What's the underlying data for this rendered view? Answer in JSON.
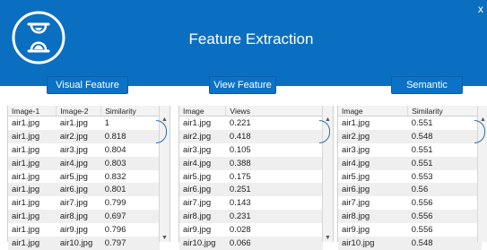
{
  "app": {
    "title": "Feature Extraction",
    "close_label": "x"
  },
  "buttons": {
    "visual": "Visual Feature",
    "view": "View Feature",
    "semantic": "Semantic Feature"
  },
  "visual_table": {
    "headers": [
      "Image-1",
      "Image-2",
      "Similarity"
    ],
    "rows": [
      [
        "air1.jpg",
        "air1.jpg",
        "1"
      ],
      [
        "air1.jpg",
        "air2.jpg",
        "0.818"
      ],
      [
        "air1.jpg",
        "air3.jpg",
        "0.804"
      ],
      [
        "air1.jpg",
        "air4.jpg",
        "0.803"
      ],
      [
        "air1.jpg",
        "air5.jpg",
        "0.832"
      ],
      [
        "air1.jpg",
        "air6.jpg",
        "0.801"
      ],
      [
        "air1.jpg",
        "air7.jpg",
        "0.799"
      ],
      [
        "air1.jpg",
        "air8.jpg",
        "0.697"
      ],
      [
        "air1.jpg",
        "air9.jpg",
        "0.796"
      ],
      [
        "air1.jpg",
        "air10.jpg",
        "0.797"
      ]
    ]
  },
  "view_table": {
    "headers": [
      "Image",
      "Views"
    ],
    "rows": [
      [
        "air1.jpg",
        "0.221"
      ],
      [
        "air2.jpg",
        "0.418"
      ],
      [
        "air3.jpg",
        "0.105"
      ],
      [
        "air4.jpg",
        "0.388"
      ],
      [
        "air5.jpg",
        "0.175"
      ],
      [
        "air6.jpg",
        "0.251"
      ],
      [
        "air7.jpg",
        "0.143"
      ],
      [
        "air8.jpg",
        "0.231"
      ],
      [
        "air9.jpg",
        "0.028"
      ],
      [
        "air10.jpg",
        "0.066"
      ]
    ]
  },
  "semantic_table": {
    "headers": [
      "Image",
      "Similarity"
    ],
    "rows": [
      [
        "air1.jpg",
        "0.551"
      ],
      [
        "air2.jpg",
        "0.548"
      ],
      [
        "air3.jpg",
        "0.551"
      ],
      [
        "air4.jpg",
        "0.551"
      ],
      [
        "air5.jpg",
        "0.553"
      ],
      [
        "air6.jpg",
        "0.56"
      ],
      [
        "air7.jpg",
        "0.556"
      ],
      [
        "air8.jpg",
        "0.556"
      ],
      [
        "air9.jpg",
        "0.556"
      ],
      [
        "air10.jpg",
        "0.548"
      ]
    ]
  },
  "icons": {
    "logo": "hourglass-icon"
  },
  "colors": {
    "header": "#0b6fc1",
    "button": "#0c72c7"
  }
}
